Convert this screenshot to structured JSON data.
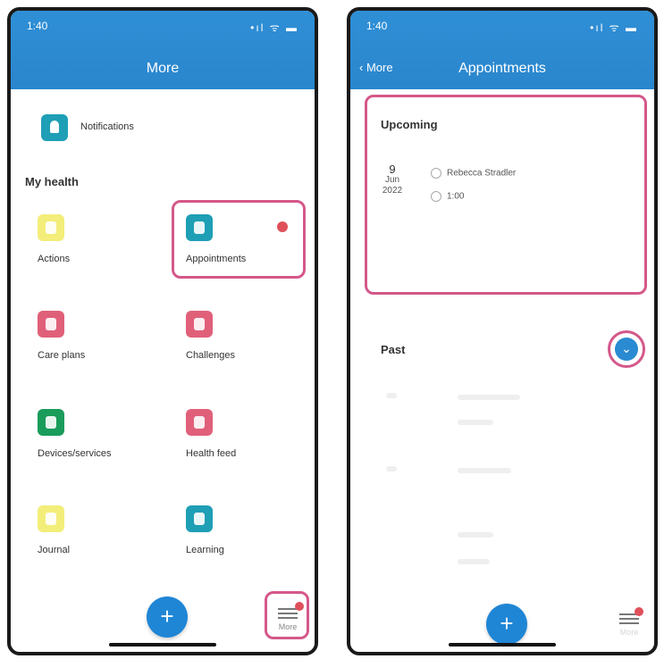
{
  "left_screen": {
    "status_time": "1:40",
    "status_icons": "•ıl ᯤ ▬",
    "title": "More",
    "notifications_label": "Notifications",
    "my_health_label": "My health",
    "tiles": [
      {
        "label": "Actions",
        "color": "#f3ee7a"
      },
      {
        "label": "Appointments",
        "color": "#1e9fb5"
      },
      {
        "label": "Care plans",
        "color": "#e0607a"
      },
      {
        "label": "Challenges",
        "color": "#e0607a"
      },
      {
        "label": "Devices/services",
        "color": "#1a9c5a"
      },
      {
        "label": "Health feed",
        "color": "#e0607a"
      },
      {
        "label": "Journal",
        "color": "#f3ee7a"
      },
      {
        "label": "Learning",
        "color": "#1e9fb5"
      }
    ],
    "fab_label": "+",
    "more_tab_label": "More"
  },
  "right_screen": {
    "status_time": "1:40",
    "status_icons": "•ıl ᯤ ▬",
    "back_label": "More",
    "title": "Appointments",
    "upcoming_label": "Upcoming",
    "upcoming_date": {
      "day": "9",
      "month": "Jun",
      "year": "2022"
    },
    "upcoming_provider": "Rebecca Stradler",
    "upcoming_time": "1:00",
    "past_label": "Past",
    "fab_label": "+",
    "more_tab_label": "More"
  },
  "colors": {
    "header_blue": "#2a86cd",
    "highlight_pink": "#d4588a",
    "fab_blue": "#1f86d6",
    "badge_red": "#e0505a"
  }
}
